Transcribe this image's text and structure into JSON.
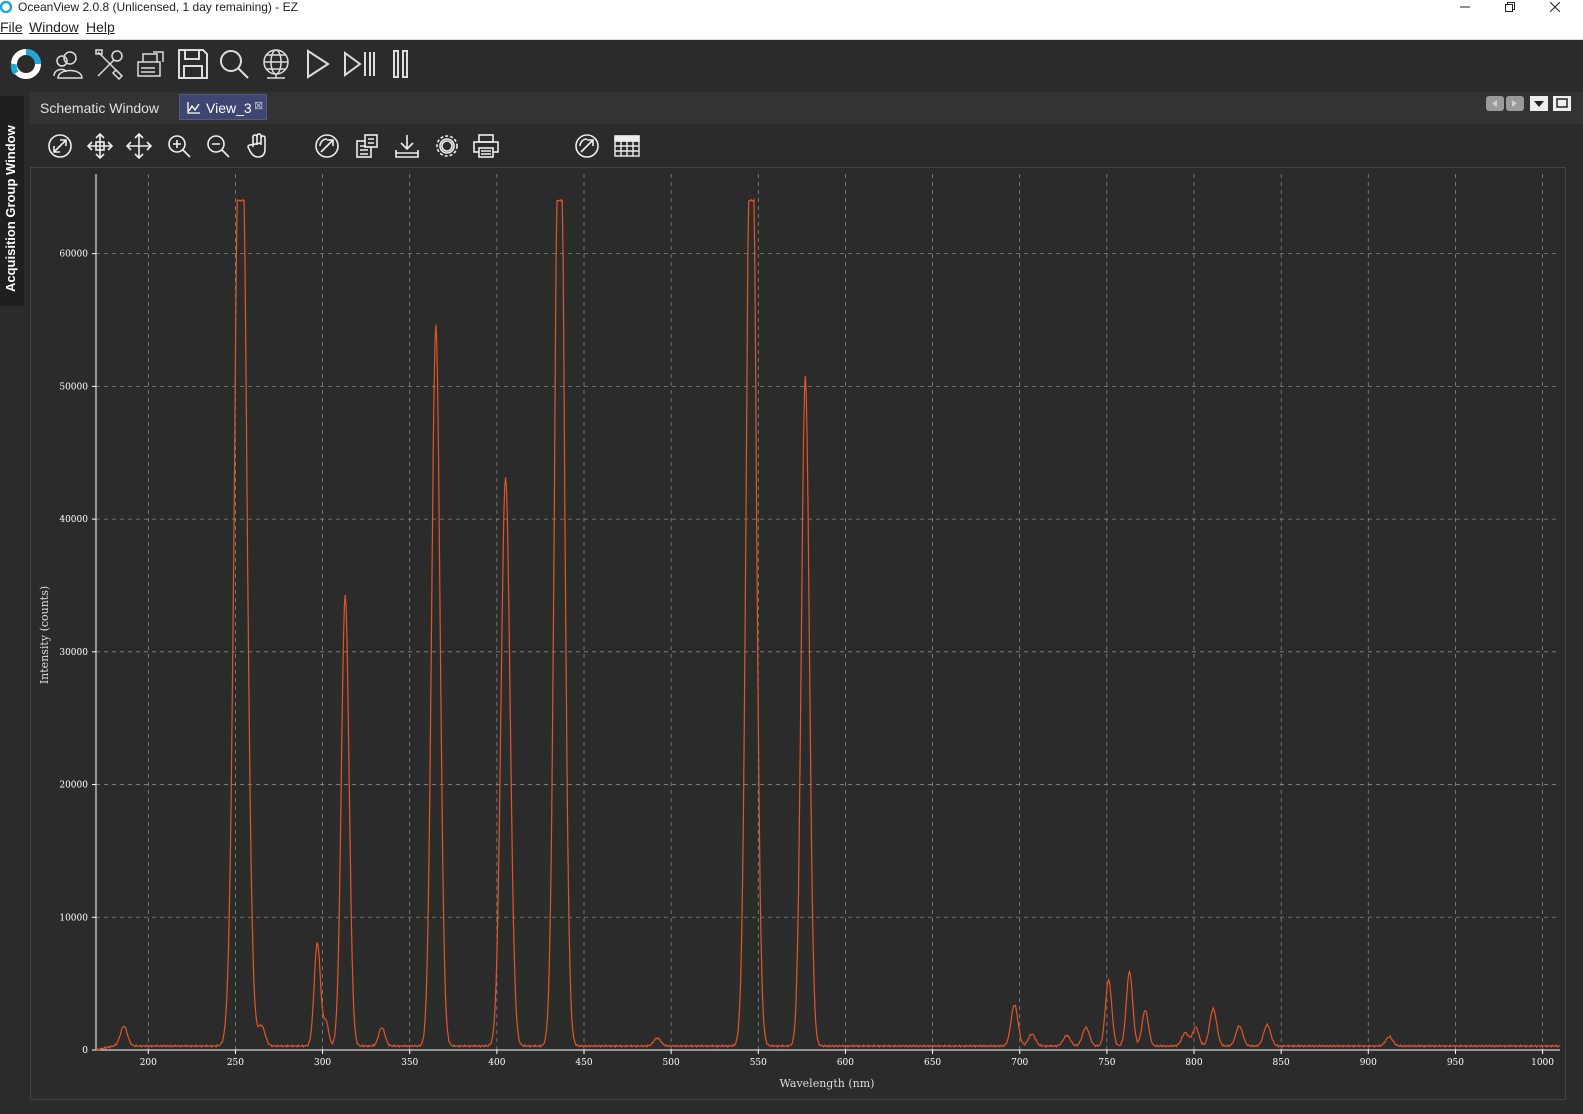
{
  "window": {
    "title": "OceanView 2.0.8 (Unlicensed, 1 day remaining) - EZ"
  },
  "menu": {
    "items": [
      {
        "label": "File"
      },
      {
        "label": "Window"
      },
      {
        "label": "Help"
      }
    ]
  },
  "toolbar": {
    "icons": [
      "oceanview-logo-icon",
      "spectrometer-user-icon",
      "tools-icon",
      "export-icon",
      "save-icon",
      "search-icon",
      "globe-icon",
      "play-icon",
      "step-icon",
      "pause-icon"
    ]
  },
  "side_panel": {
    "label": "Acquisition Group Window"
  },
  "tabs": [
    {
      "label": "Schematic Window",
      "active": false
    },
    {
      "label": "View_3",
      "active": true
    }
  ],
  "plot_toolbar": {
    "icons": [
      "auto-scale-icon",
      "scale-horizontal-icon",
      "scale-vertical-icon",
      "zoom-in-icon",
      "zoom-out-icon",
      "pan-icon",
      "refresh-icon",
      "overlay-icon",
      "download-icon",
      "settings-icon",
      "print-icon",
      "table-icon"
    ]
  },
  "colors": {
    "background": "#2b2b2b",
    "plot_background": "#2b2b2b",
    "grid": "#8a8a8a",
    "trace": "#e0552a",
    "active_tab": "#3d4570"
  },
  "chart_data": {
    "type": "line",
    "title": "",
    "xlabel": "Wavelength (nm)",
    "ylabel": "Intensity (counts)",
    "xlim": [
      170,
      1010
    ],
    "ylim": [
      0,
      66000
    ],
    "grid": true,
    "x_ticks": [
      "200",
      "250",
      "300",
      "350",
      "400",
      "450",
      "500",
      "550",
      "600",
      "650",
      "700",
      "750",
      "800",
      "850",
      "900",
      "950",
      "1000"
    ],
    "y_ticks": [
      "0",
      "10000",
      "20000",
      "30000",
      "40000",
      "50000",
      "60000"
    ],
    "baseline": 300,
    "peaks": [
      {
        "x": 186,
        "y": 1500,
        "w": 2
      },
      {
        "x": 253,
        "y": 64000,
        "w": 3.2,
        "saturated": true
      },
      {
        "x": 265,
        "y": 1500,
        "w": 2
      },
      {
        "x": 297,
        "y": 7800,
        "w": 1.8
      },
      {
        "x": 302,
        "y": 1800,
        "w": 1.5
      },
      {
        "x": 313,
        "y": 34000,
        "w": 2.2
      },
      {
        "x": 334,
        "y": 1400,
        "w": 1.8
      },
      {
        "x": 365,
        "y": 54300,
        "w": 2.4
      },
      {
        "x": 405,
        "y": 42900,
        "w": 2.6
      },
      {
        "x": 436,
        "y": 64000,
        "w": 2.6,
        "saturated": true
      },
      {
        "x": 492,
        "y": 600,
        "w": 2
      },
      {
        "x": 546,
        "y": 64000,
        "w": 2.6,
        "saturated": true
      },
      {
        "x": 577,
        "y": 50500,
        "w": 2.3
      },
      {
        "x": 697,
        "y": 3100,
        "w": 2
      },
      {
        "x": 707,
        "y": 900,
        "w": 2
      },
      {
        "x": 727,
        "y": 800,
        "w": 2
      },
      {
        "x": 738,
        "y": 1400,
        "w": 2
      },
      {
        "x": 751,
        "y": 5000,
        "w": 1.8
      },
      {
        "x": 763,
        "y": 5600,
        "w": 1.8
      },
      {
        "x": 772,
        "y": 2700,
        "w": 1.8
      },
      {
        "x": 795,
        "y": 1000,
        "w": 2
      },
      {
        "x": 801,
        "y": 1400,
        "w": 1.8
      },
      {
        "x": 811,
        "y": 2800,
        "w": 2
      },
      {
        "x": 826,
        "y": 1500,
        "w": 2
      },
      {
        "x": 842,
        "y": 1600,
        "w": 2
      },
      {
        "x": 912,
        "y": 700,
        "w": 2
      }
    ]
  }
}
